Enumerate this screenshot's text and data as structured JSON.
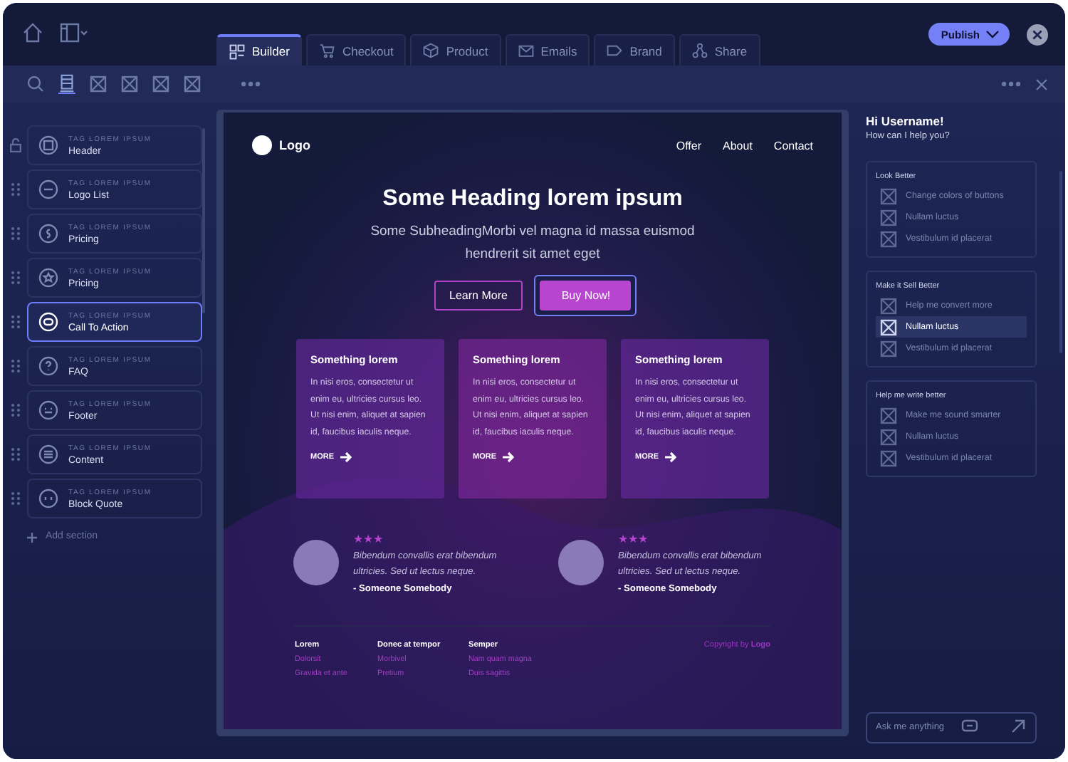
{
  "top_bar": {
    "tabs": [
      {
        "label": "Builder",
        "selected": true
      },
      {
        "label": "Checkout",
        "selected": false
      },
      {
        "label": "Product",
        "selected": false
      },
      {
        "label": "Emails",
        "selected": false
      },
      {
        "label": "Brand",
        "selected": false
      },
      {
        "label": "Share",
        "selected": false
      }
    ],
    "publish_button": "Publish"
  },
  "sections": {
    "items": [
      {
        "tag": "TAG LOREM IPSUM",
        "name": "Header",
        "selected": false,
        "locked": true
      },
      {
        "tag": "TAG LOREM IPSUM",
        "name": "Logo List",
        "selected": false,
        "locked": false
      },
      {
        "tag": "TAG LOREM IPSUM",
        "name": "Pricing",
        "selected": false,
        "locked": false
      },
      {
        "tag": "TAG LOREM IPSUM",
        "name": "Pricing",
        "selected": false,
        "locked": false
      },
      {
        "tag": "TAG LOREM IPSUM",
        "name": "Call To Action",
        "selected": true,
        "locked": false
      },
      {
        "tag": "TAG LOREM IPSUM",
        "name": "FAQ",
        "selected": false,
        "locked": false
      },
      {
        "tag": "TAG LOREM IPSUM",
        "name": "Footer",
        "selected": false,
        "locked": false
      },
      {
        "tag": "TAG LOREM IPSUM",
        "name": "Content",
        "selected": false,
        "locked": false
      },
      {
        "tag": "TAG LOREM IPSUM",
        "name": "Block Quote",
        "selected": false,
        "locked": false
      }
    ],
    "add_section": "Add section"
  },
  "preview": {
    "logo": "Logo",
    "nav_links": [
      "Offer",
      "About",
      "Contact"
    ],
    "heading": "Some Heading lorem ipsum",
    "subheading": "Some SubheadingMorbi vel magna id massa euismod hendrerit sit amet eget",
    "buttons": [
      {
        "label": "Learn More",
        "kind": "outline",
        "selected": false
      },
      {
        "label": "Buy Now!",
        "kind": "filled",
        "selected": true
      }
    ],
    "cards": [
      {
        "title": "Something lorem",
        "body": "In nisi eros, consectetur ut enim eu, ultricies cursus leo. Ut nisi enim, aliquet at sapien id, faucibus iaculis neque.",
        "link": "MORE"
      },
      {
        "title": "Something lorem",
        "body": "In nisi eros, consectetur ut enim eu, ultricies cursus leo. Ut nisi enim, aliquet at sapien id, faucibus iaculis neque.",
        "link": "MORE"
      },
      {
        "title": "Something lorem",
        "body": "In nisi eros, consectetur ut enim eu, ultricies cursus leo. Ut nisi enim, aliquet at sapien id, faucibus iaculis neque.",
        "link": "MORE"
      }
    ],
    "testimonials": [
      {
        "stars": 3,
        "quote": "Bibendum convallis erat bibendum ultricies. Sed ut lectus neque.",
        "author": "- Someone Somebody"
      },
      {
        "stars": 3,
        "quote": "Bibendum convallis erat bibendum ultricies. Sed ut lectus neque.",
        "author": "- Someone Somebody"
      }
    ],
    "footer": {
      "columns": [
        {
          "heading": "Lorem",
          "links": [
            "Dolorsit",
            "Gravida et ante"
          ]
        },
        {
          "heading": "Donec at tempor",
          "links": [
            "Morbivel",
            "Pretium"
          ]
        },
        {
          "heading": "Semper",
          "links": [
            "Nam quam magna",
            "Duis sagittis"
          ]
        }
      ],
      "copyright": "Copyright by **Logo**"
    }
  },
  "assistant": {
    "greeting": "Hi Username!",
    "question": "How can I help you?",
    "groups": [
      {
        "title": "Look Better",
        "items": [
          {
            "label": "Change colors of buttons",
            "selected": false
          },
          {
            "label": "Nullam luctus",
            "selected": false
          },
          {
            "label": "Vestibulum id placerat",
            "selected": false
          }
        ]
      },
      {
        "title": "Make it Sell Better",
        "items": [
          {
            "label": "Help me convert more",
            "selected": false
          },
          {
            "label": "Nullam luctus",
            "selected": true
          },
          {
            "label": "Vestibulum id placerat",
            "selected": false
          }
        ]
      },
      {
        "title": "Help me write better",
        "items": [
          {
            "label": "Make me sound smarter",
            "selected": false
          },
          {
            "label": "Nullam luctus",
            "selected": false
          },
          {
            "label": "Vestibulum id placerat",
            "selected": false
          }
        ]
      }
    ],
    "input": {
      "placeholder": "Ask me anything"
    }
  }
}
